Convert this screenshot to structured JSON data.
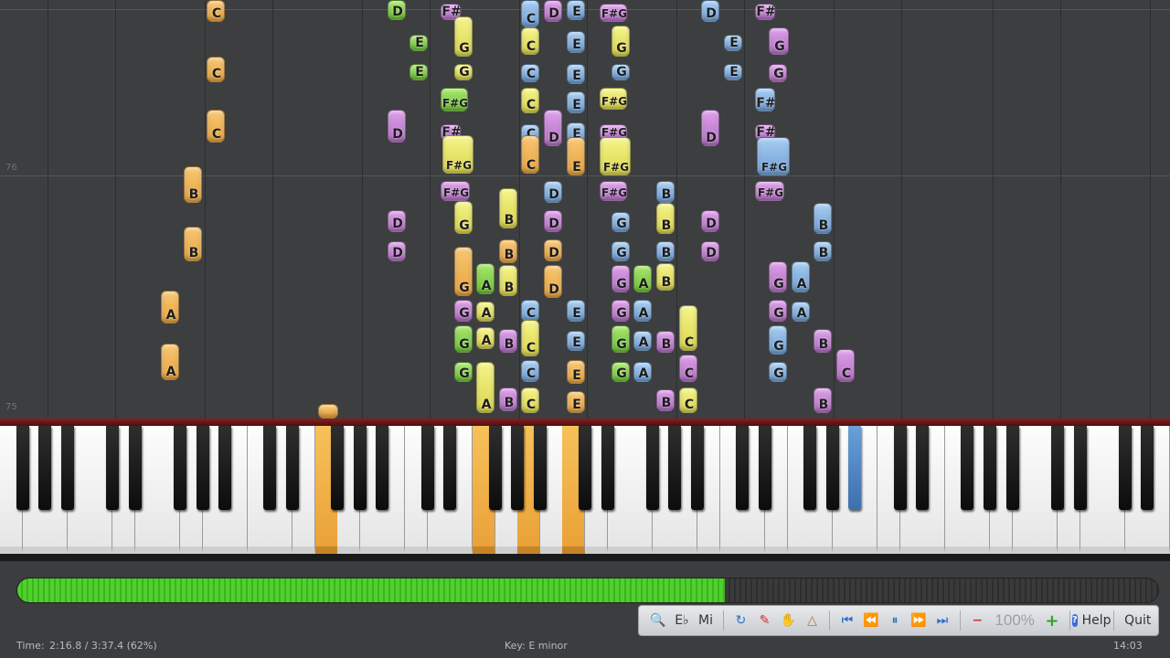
{
  "roll": {
    "measure_top": "76",
    "measure_bottom": "75"
  },
  "notes": [
    {
      "label": "C",
      "color": "orange"
    },
    {
      "label": "C",
      "color": "orange"
    },
    {
      "label": "C",
      "color": "orange"
    },
    {
      "label": "B",
      "color": "orange"
    },
    {
      "label": "B",
      "color": "orange"
    },
    {
      "label": "A",
      "color": "orange"
    },
    {
      "label": "A",
      "color": "orange"
    },
    {
      "label": "D",
      "color": "green"
    },
    {
      "label": "E",
      "color": "green"
    },
    {
      "label": "E",
      "color": "green"
    },
    {
      "label": "D",
      "color": "purple"
    },
    {
      "label": "D",
      "color": "purple"
    },
    {
      "label": "D",
      "color": "purple"
    },
    {
      "label": "F#",
      "color": "purple"
    },
    {
      "label": "G",
      "color": "yellow"
    },
    {
      "label": "G",
      "color": "yellow"
    },
    {
      "label": "F#G",
      "color": "green"
    },
    {
      "label": "F#",
      "color": "purple"
    },
    {
      "label": "F#G",
      "color": "yellow"
    },
    {
      "label": "F#G",
      "color": "purple"
    },
    {
      "label": "G",
      "color": "yellow"
    },
    {
      "label": "B",
      "color": "yellow"
    },
    {
      "label": "B",
      "color": "orange"
    },
    {
      "label": "G",
      "color": "orange"
    },
    {
      "label": "A",
      "color": "green"
    },
    {
      "label": "B",
      "color": "yellow"
    },
    {
      "label": "G",
      "color": "purple"
    },
    {
      "label": "A",
      "color": "yellow"
    },
    {
      "label": "G",
      "color": "green"
    },
    {
      "label": "A",
      "color": "yellow"
    },
    {
      "label": "B",
      "color": "purple"
    },
    {
      "label": "G",
      "color": "green"
    },
    {
      "label": "A",
      "color": "yellow"
    },
    {
      "label": "B",
      "color": "purple"
    },
    {
      "label": "C",
      "color": "blue"
    },
    {
      "label": "C",
      "color": "yellow"
    },
    {
      "label": "C",
      "color": "blue"
    },
    {
      "label": "C",
      "color": "yellow"
    },
    {
      "label": "C",
      "color": "blue"
    },
    {
      "label": "C",
      "color": "orange"
    },
    {
      "label": "C",
      "color": "blue"
    },
    {
      "label": "C",
      "color": "yellow"
    },
    {
      "label": "C",
      "color": "blue"
    },
    {
      "label": "C",
      "color": "yellow"
    },
    {
      "label": "D",
      "color": "purple"
    },
    {
      "label": "D",
      "color": "purple"
    },
    {
      "label": "D",
      "color": "blue"
    },
    {
      "label": "D",
      "color": "purple"
    },
    {
      "label": "D",
      "color": "orange"
    },
    {
      "label": "D",
      "color": "orange"
    },
    {
      "label": "E",
      "color": "blue"
    },
    {
      "label": "E",
      "color": "blue"
    },
    {
      "label": "E",
      "color": "blue"
    },
    {
      "label": "E",
      "color": "blue"
    },
    {
      "label": "E",
      "color": "blue"
    },
    {
      "label": "E",
      "color": "orange"
    },
    {
      "label": "E",
      "color": "blue"
    },
    {
      "label": "E",
      "color": "blue"
    },
    {
      "label": "E",
      "color": "orange"
    },
    {
      "label": "E",
      "color": "orange"
    },
    {
      "label": "F#G",
      "color": "purple"
    },
    {
      "label": "G",
      "color": "yellow"
    },
    {
      "label": "G",
      "color": "blue"
    },
    {
      "label": "F#G",
      "color": "yellow"
    },
    {
      "label": "F#G",
      "color": "purple"
    },
    {
      "label": "F#G",
      "color": "yellow"
    },
    {
      "label": "F#G",
      "color": "purple"
    },
    {
      "label": "G",
      "color": "blue"
    },
    {
      "label": "G",
      "color": "blue"
    },
    {
      "label": "G",
      "color": "purple"
    },
    {
      "label": "A",
      "color": "green"
    },
    {
      "label": "B",
      "color": "yellow"
    },
    {
      "label": "G",
      "color": "purple"
    },
    {
      "label": "A",
      "color": "blue"
    },
    {
      "label": "G",
      "color": "green"
    },
    {
      "label": "A",
      "color": "blue"
    },
    {
      "label": "B",
      "color": "purple"
    },
    {
      "label": "G",
      "color": "green"
    },
    {
      "label": "A",
      "color": "blue"
    },
    {
      "label": "B",
      "color": "blue"
    },
    {
      "label": "B",
      "color": "yellow"
    },
    {
      "label": "B",
      "color": "blue"
    },
    {
      "label": "C",
      "color": "yellow"
    },
    {
      "label": "C",
      "color": "purple"
    },
    {
      "label": "B",
      "color": "purple"
    },
    {
      "label": "C",
      "color": "yellow"
    },
    {
      "label": "D",
      "color": "blue"
    },
    {
      "label": "E",
      "color": "blue"
    },
    {
      "label": "E",
      "color": "blue"
    },
    {
      "label": "D",
      "color": "purple"
    },
    {
      "label": "D",
      "color": "purple"
    },
    {
      "label": "D",
      "color": "purple"
    },
    {
      "label": "F#",
      "color": "purple"
    },
    {
      "label": "G",
      "color": "purple"
    },
    {
      "label": "G",
      "color": "purple"
    },
    {
      "label": "F#",
      "color": "blue"
    },
    {
      "label": "F#",
      "color": "purple"
    },
    {
      "label": "F#G",
      "color": "blue"
    },
    {
      "label": "F#G",
      "color": "purple"
    },
    {
      "label": "B",
      "color": "blue"
    },
    {
      "label": "B",
      "color": "blue"
    },
    {
      "label": "G",
      "color": "purple"
    },
    {
      "label": "A",
      "color": "blue"
    },
    {
      "label": "G",
      "color": "purple"
    },
    {
      "label": "A",
      "color": "blue"
    },
    {
      "label": "G",
      "color": "blue"
    },
    {
      "label": "B",
      "color": "purple"
    },
    {
      "label": "G",
      "color": "blue"
    },
    {
      "label": "C",
      "color": "purple"
    },
    {
      "label": "B",
      "color": "purple"
    },
    {
      "label": "",
      "color": "orange"
    }
  ],
  "progress": {
    "fraction": 0.62
  },
  "toolbar": {
    "zoom_value": "100%",
    "help_label": "Help",
    "quit_label": "Quit",
    "btn_eb": "E♭",
    "btn_mi": "Mi"
  },
  "status": {
    "time_label": "Time:",
    "time_value": "2:16.8 / 3:37.4 (62%)",
    "key_text": "Key: E minor",
    "clock": "14:03"
  },
  "colors": {
    "orange": "#eda63f",
    "yellow": "#e3de55",
    "green": "#7fcc43",
    "purple": "#c47fd4",
    "blue": "#7eaedf",
    "progress": "#47c526"
  }
}
